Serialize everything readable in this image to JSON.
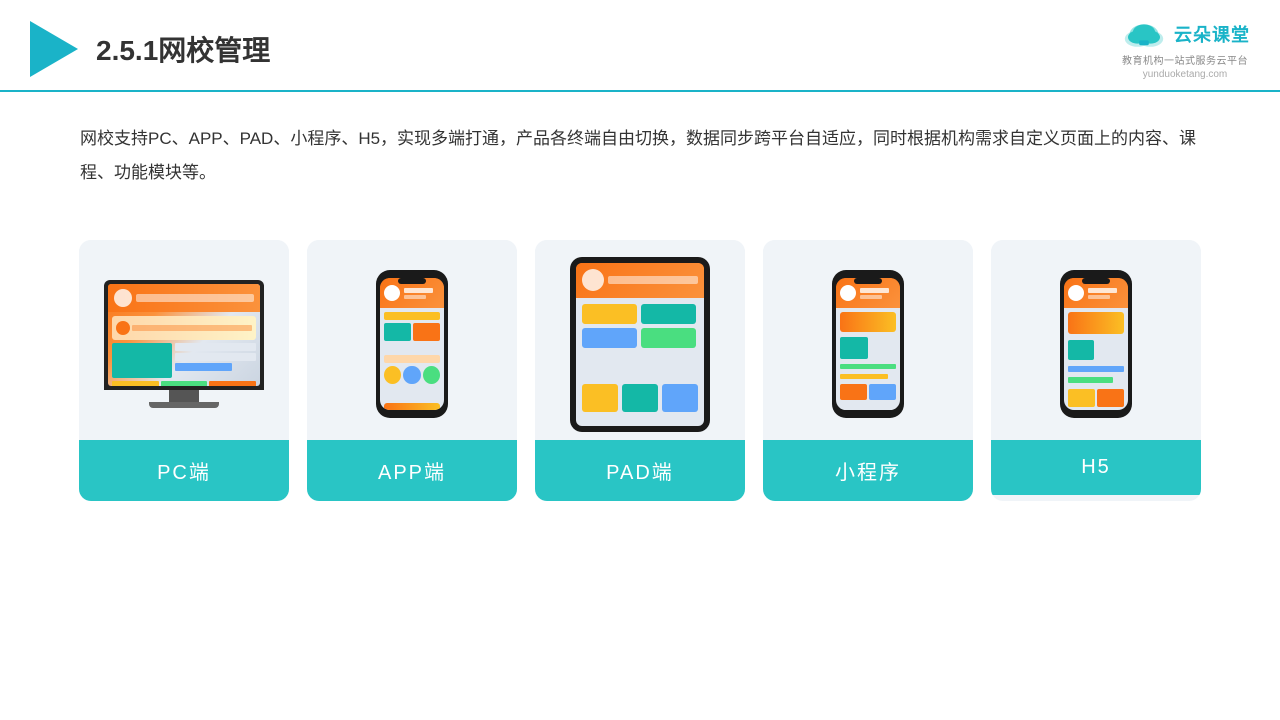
{
  "header": {
    "title": "2.5.1网校管理",
    "brand": {
      "name": "云朵课堂",
      "url": "yunduoketang.com",
      "tagline": "教育机构一站\n式服务云平台"
    }
  },
  "description": "网校支持PC、APP、PAD、小程序、H5，实现多端打通，产品各终端自由切换，数据同步跨平台自适应，同时根据机构需求自定义页面上的内容、课程、功能模块等。",
  "cards": [
    {
      "id": "pc",
      "label": "PC端"
    },
    {
      "id": "app",
      "label": "APP端"
    },
    {
      "id": "pad",
      "label": "PAD端"
    },
    {
      "id": "miniprogram",
      "label": "小程序"
    },
    {
      "id": "h5",
      "label": "H5"
    }
  ],
  "accent_color": "#29c5c5"
}
